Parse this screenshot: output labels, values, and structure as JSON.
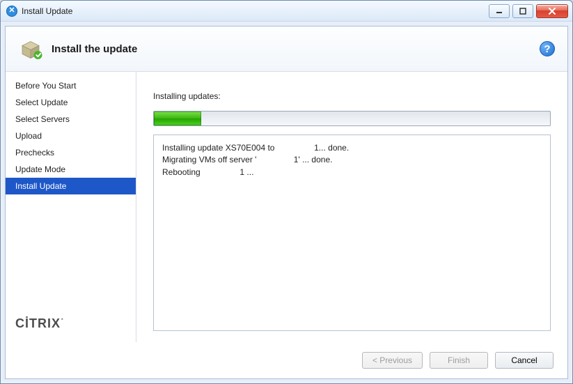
{
  "window": {
    "title": "Install Update"
  },
  "header": {
    "heading": "Install the update"
  },
  "sidebar": {
    "steps": [
      {
        "label": "Before You Start"
      },
      {
        "label": "Select Update"
      },
      {
        "label": "Select Servers"
      },
      {
        "label": "Upload"
      },
      {
        "label": "Prechecks"
      },
      {
        "label": "Update Mode"
      },
      {
        "label": "Install Update"
      }
    ],
    "active_index": 6,
    "brand": "CİTRIX"
  },
  "main": {
    "label": "Installing updates:",
    "progress_percent": 12,
    "log_text": "Installing update XS70E004 to                 1... done.\nMigrating VMs off server '                1' ... done.\nRebooting                 1 ..."
  },
  "footer": {
    "previous": "< Previous",
    "finish": "Finish",
    "cancel": "Cancel",
    "previous_enabled": false,
    "finish_enabled": false,
    "cancel_enabled": true
  }
}
